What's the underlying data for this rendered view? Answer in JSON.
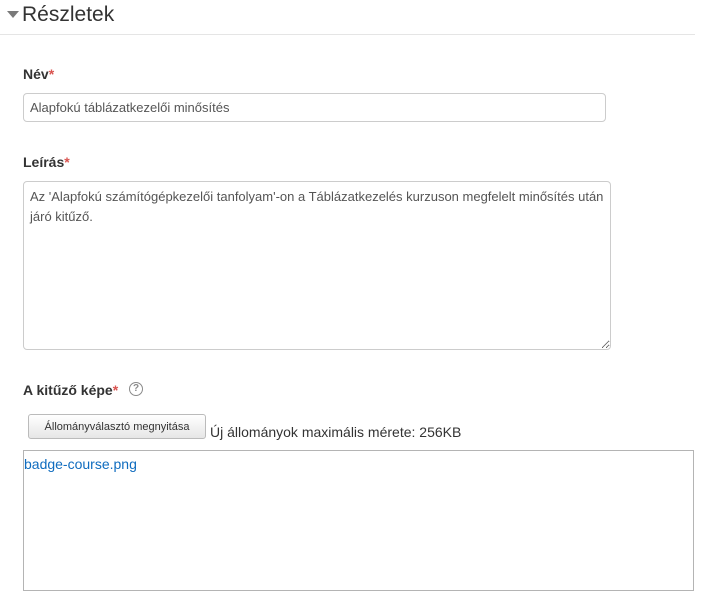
{
  "section": {
    "title": "Részletek"
  },
  "fields": {
    "name": {
      "label": "Név",
      "required_mark": "*",
      "value": "Alapfokú táblázatkezelői minősítés"
    },
    "description": {
      "label": "Leírás",
      "required_mark": "*",
      "value": "Az 'Alapfokú számítógépkezelői tanfolyam'-on a Táblázatkezelés kurzuson megfelelt minősítés után járó kitűző."
    },
    "image": {
      "label": "A kitűző képe",
      "required_mark": "*",
      "help_icon": "question-circle-icon",
      "help_glyph": "?",
      "picker_button_label": "Állományválasztó megnyitása",
      "max_size_text": "Új állományok maximális mérete: 256KB",
      "files": [
        {
          "name": "badge-course.png"
        }
      ]
    }
  },
  "colors": {
    "required": "#d9534f",
    "link": "#0f6cbf"
  }
}
